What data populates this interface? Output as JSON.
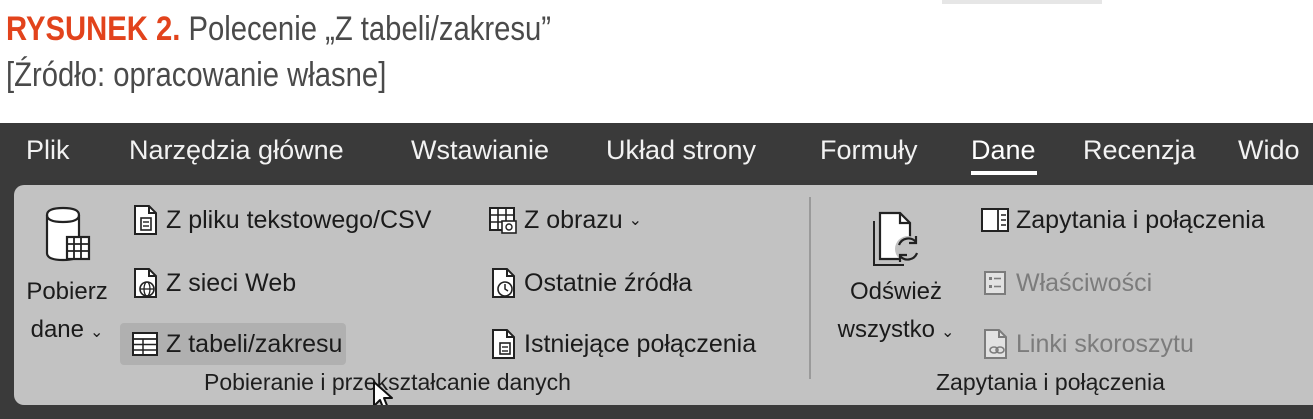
{
  "caption": {
    "figure_label": "RYSUNEK 2.",
    "title": " Polecenie „Z tabeli/zakresu”",
    "source": "[Źródło: opracowanie własne]"
  },
  "tabs": [
    {
      "label": "Plik"
    },
    {
      "label": "Narzędzia główne"
    },
    {
      "label": "Wstawianie"
    },
    {
      "label": "Układ strony"
    },
    {
      "label": "Formuły"
    },
    {
      "label": "Dane",
      "active": true
    },
    {
      "label": "Recenzja"
    },
    {
      "label": "Wido"
    }
  ],
  "groups": {
    "get_data": {
      "label": "Pobieranie i przekształcanie danych",
      "big_button": {
        "line1": "Pobierz",
        "line2": "dane",
        "caret": "⌄",
        "icon": "database-icon"
      },
      "commands": {
        "from_text": {
          "label": "Z pliku tekstowego/CSV",
          "icon": "text-file-icon"
        },
        "from_web": {
          "label": "Z sieci Web",
          "icon": "web-file-icon"
        },
        "from_table": {
          "label": "Z tabeli/zakresu",
          "icon": "table-icon"
        },
        "from_picture": {
          "label": "Z obrazu",
          "caret": "⌄",
          "icon": "picture-table-icon"
        },
        "recent_sources": {
          "label": "Ostatnie źródła",
          "icon": "recent-sources-icon"
        },
        "existing_connections": {
          "label": "Istniejące połączenia",
          "icon": "existing-connections-icon"
        }
      }
    },
    "queries": {
      "label": "Zapytania i połączenia",
      "big_button": {
        "line1": "Odśwież",
        "line2": "wszystko",
        "caret": "⌄",
        "icon": "refresh-all-icon"
      },
      "commands": {
        "queries_connections": {
          "label": "Zapytania i połączenia",
          "icon": "queries-pane-icon"
        },
        "properties": {
          "label": "Właściwości",
          "icon": "properties-icon",
          "disabled": true
        },
        "workbook_links": {
          "label": "Linki skoroszytu",
          "icon": "workbook-links-icon",
          "disabled": true
        }
      }
    }
  },
  "colors": {
    "accent_caption": "#e2431c",
    "tab_bar": "#3a3a3a",
    "ribbon": "#c2c2c2"
  }
}
